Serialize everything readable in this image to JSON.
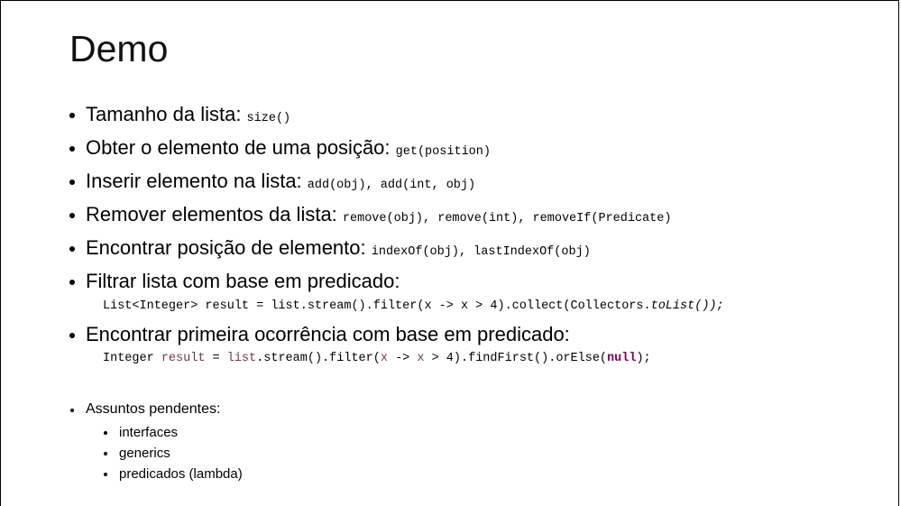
{
  "slide": {
    "title": "Demo",
    "bullets": [
      {
        "text": "Tamanho da lista: ",
        "code": "size()"
      },
      {
        "text": "Obter o elemento de uma posição: ",
        "code": "get(position)"
      },
      {
        "text": "Inserir elemento na lista: ",
        "code": "add(obj), add(int, obj)"
      },
      {
        "text": "Remover elementos da lista: ",
        "code": "remove(obj), remove(int), removeIf(Predicate)"
      },
      {
        "text": "Encontrar posição de elemento: ",
        "code": "indexOf(obj), lastIndexOf(obj)"
      },
      {
        "text": "Filtrar lista com base em predicado:"
      },
      {
        "text": "Encontrar primeira ocorrência com base em predicado:"
      }
    ],
    "code1": {
      "prefix": "List<Integer> result = list.stream().filter(x -> x > 4).collect(Collectors.",
      "italic": "toList());"
    },
    "code2": {
      "p1": "Integer ",
      "var1": "result",
      "p2": " = ",
      "var2": "list",
      "p3": ".stream().filter(",
      "x1": "x",
      "p4": " -> ",
      "x2": "x",
      "p5": " > 4).findFirst().orElse(",
      "kw": "null",
      "p6": ");"
    },
    "pending": {
      "label": "Assuntos pendentes:",
      "items": [
        "interfaces",
        "generics",
        "predicados (lambda)"
      ]
    }
  }
}
